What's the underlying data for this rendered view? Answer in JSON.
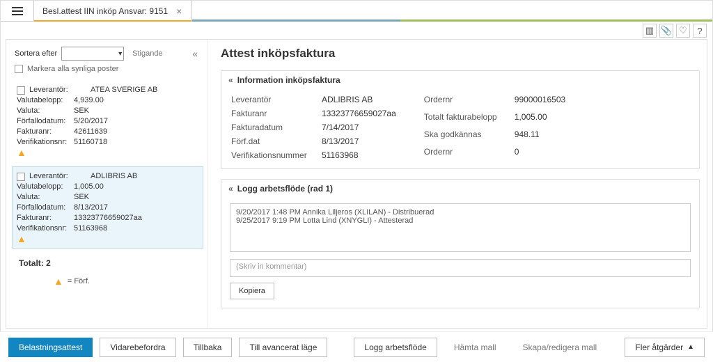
{
  "tab": {
    "title": "Besl.attest IIN inköp Ansvar: 9151"
  },
  "utilIcons": {
    "split": "▥",
    "attach": "📎",
    "fav": "♡",
    "help": "?"
  },
  "sort": {
    "label": "Sortera efter",
    "ascending": "Stigande",
    "markAll": "Markera alla synliga poster"
  },
  "items": [
    {
      "supplierLabel": "Leverantör:",
      "supplier": "ATEA SVERIGE AB",
      "amountLabel": "Valutabelopp:",
      "amount": "4,939.00",
      "currencyLabel": "Valuta:",
      "currency": "SEK",
      "dueLabel": "Förfallodatum:",
      "due": "5/20/2017",
      "invoiceLabel": "Fakturanr:",
      "invoice": "42611639",
      "verifLabel": "Verifikationsnr:",
      "verif": "51160718"
    },
    {
      "supplierLabel": "Leverantör:",
      "supplier": "ADLIBRIS AB",
      "amountLabel": "Valutabelopp:",
      "amount": "1,005.00",
      "currencyLabel": "Valuta:",
      "currency": "SEK",
      "dueLabel": "Förfallodatum:",
      "due": "8/13/2017",
      "invoiceLabel": "Fakturanr:",
      "invoice": "13323776659027aa",
      "verifLabel": "Verifikationsnr:",
      "verif": "51163968"
    }
  ],
  "totals": "Totalt: 2",
  "legend": {
    "icon": "▲",
    "text": "= Förf."
  },
  "pageTitle": "Attest inköpsfaktura",
  "infoSection": {
    "title": "Information inköpsfaktura",
    "left": {
      "supplierK": "Leverantör",
      "supplierV": "ADLIBRIS AB",
      "invoiceK": "Fakturanr",
      "invoiceV": "13323776659027aa",
      "invdateK": "Fakturadatum",
      "invdateV": "7/14/2017",
      "dueK": "Förf.dat",
      "dueV": "8/13/2017",
      "verifK": "Verifikationsnummer",
      "verifV": "51163968"
    },
    "right": {
      "orderK": "Ordernr",
      "orderV": "99000016503",
      "totalK": "Totalt fakturabelopp",
      "totalV": "1,005.00",
      "approveK": "Ska godkännas",
      "approveV": "948.11",
      "order2K": "Ordernr",
      "order2V": "0"
    }
  },
  "logSection": {
    "title": "Logg arbetsflöde (rad 1)",
    "line1": "9/20/2017 1:48 PM Annika Liljeros (XLILAN) - Distribuerad",
    "line2": "9/25/2017 9:19 PM Lotta Lind (XNYGLI) - Attesterad",
    "commentPlaceholder": "(Skriv in kommentar)",
    "copy": "Kopiera"
  },
  "footer": {
    "primary": "Belastningsattest",
    "forward": "Vidarebefordra",
    "back": "Tillbaka",
    "advanced": "Till avancerat läge",
    "logFlow": "Logg arbetsflöde",
    "getTemplate": "Hämta mall",
    "editTemplate": "Skapa/redigera mall",
    "more": "Fler åtgärder"
  }
}
